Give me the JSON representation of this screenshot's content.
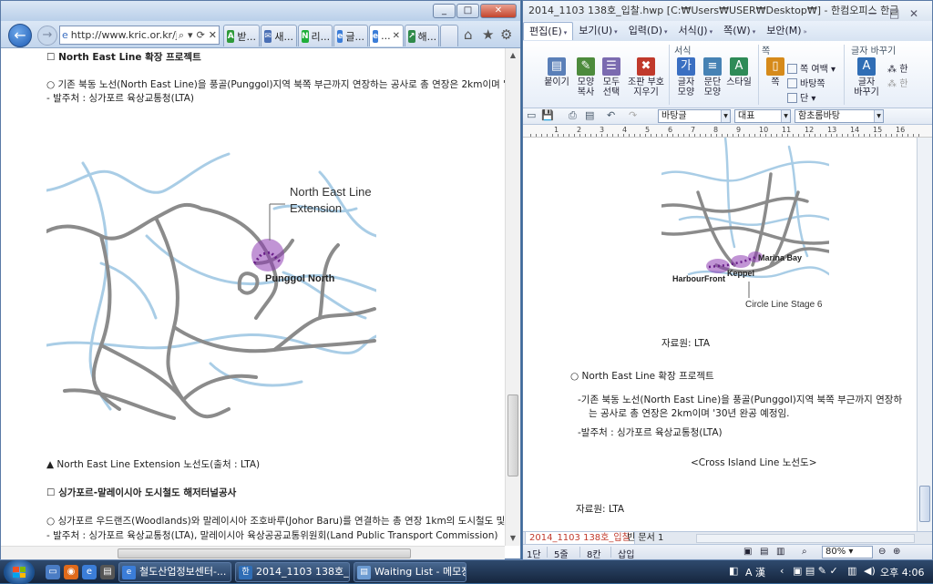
{
  "ie": {
    "window_buttons": [
      "_",
      "□",
      "✕"
    ],
    "address_url": "http://www.kric.or.kr/js",
    "address_actions": [
      "⌕",
      "▾",
      "⟳",
      "✕"
    ],
    "tabs": [
      {
        "label": "받...",
        "icon": "green-tab-icon",
        "color": "#2f9a3a",
        "glyph": "A"
      },
      {
        "label": "새...",
        "icon": "mail-tab-icon",
        "color": "#4a6fb5",
        "glyph": "✉"
      },
      {
        "label": "리...",
        "icon": "naver-tab-icon",
        "color": "#1fae3a",
        "glyph": "N"
      },
      {
        "label": "글...",
        "icon": "ie-tab-icon",
        "color": "#3b7dd8",
        "glyph": "e"
      },
      {
        "label": "...",
        "icon": "ie-tab-icon",
        "color": "#3b7dd8",
        "glyph": "e",
        "active": true
      },
      {
        "label": "해...",
        "icon": "green-arrow-tab-icon",
        "color": "#2f8a4a",
        "glyph": "↗"
      }
    ],
    "right_icons": [
      "⌂",
      "★",
      "⚙"
    ],
    "content": {
      "heading1": "☐ North East Line 확장 프로젝트",
      "bullet1": "○ 기존 북동 노선(North East Line)을 풍골(Punggol)지역 북쪽 부근까지 연장하는 공사로 총 연장은 2km이며 '",
      "owner1": "- 발주처 : 싱가포르 육상교통청(LTA)",
      "map_label_title_line1": "North East Line",
      "map_label_title_line2": "Extension",
      "map_label_station": "Punggol North",
      "caption": "▲ North East Line Extension 노선도(출처 : LTA)",
      "heading2": "☐ 싱가포르-말레이시아 도시철도 해저터널공사",
      "bullet2": "○ 싱가포르 우드랜즈(Woodlands)와 말레이시아 조호바루(Johor Baru)를 연결하는 총 연장 1km의 도시철도 및",
      "owner2": "- 발주처 : 싱가포르 육상교통청(LTA), 말레이시아 육상공공교통위원회(Land Public Transport Commission)"
    }
  },
  "hwp": {
    "title": "2014_1103 138호_입찰.hwp [C:₩Users₩USER₩Desktop₩] - 한컴오피스 한글",
    "title_buttons": [
      "─",
      "□",
      "✕"
    ],
    "menu": [
      {
        "label": "편집(E)",
        "active": true
      },
      {
        "label": "보기(U)"
      },
      {
        "label": "입력(D)"
      },
      {
        "label": "서식(J)"
      },
      {
        "label": "쪽(W)"
      },
      {
        "label": "보안(M)"
      }
    ],
    "ribbon": {
      "group_format": "서식",
      "group_page": "쪽",
      "group_char": "글자 바꾸기",
      "buttons": [
        {
          "label": "붙이기",
          "icon": "paste-icon",
          "color": "#5a7fb8",
          "glyph": "▤"
        },
        {
          "label": "모양\n복사",
          "icon": "format-painter-icon",
          "color": "#4d8b3c",
          "glyph": "✎"
        },
        {
          "label": "모두\n선택",
          "icon": "select-all-icon",
          "color": "#7b6bb0",
          "glyph": "☰"
        },
        {
          "label": "조판 부호\n지우기",
          "icon": "clear-code-icon",
          "color": "#c0392b",
          "glyph": "✖"
        },
        {
          "label": "글자\n모양",
          "icon": "char-shape-icon",
          "color": "#3a6fc2",
          "glyph": "가"
        },
        {
          "label": "문단\n모양",
          "icon": "para-shape-icon",
          "color": "#4682b4",
          "glyph": "≡"
        },
        {
          "label": "스타일",
          "icon": "style-icon",
          "color": "#2e8b57",
          "glyph": "A"
        },
        {
          "label": "쪽",
          "icon": "page-icon",
          "color": "#d68a1a",
          "glyph": "▯"
        },
        {
          "label": "글자\n바꾸기",
          "icon": "char-replace-icon",
          "color": "#2f6db5",
          "glyph": "A"
        }
      ],
      "small_items": [
        "쪽 여백",
        "바탕쪽",
        "단",
        "한",
        "한"
      ]
    },
    "toolbar": {
      "font_combo": "바탕글",
      "size_combo": "대표",
      "font_name": "함초롬바탕"
    },
    "ruler_numbers": [
      "1",
      "2",
      "3",
      "4",
      "5",
      "6",
      "7",
      "8",
      "9",
      "10",
      "11",
      "12",
      "13",
      "14",
      "15",
      "16"
    ],
    "page": {
      "map_label_marina": "Marina Bay",
      "map_label_keppel": "Keppel",
      "map_label_harbourfront": "HarbourFront",
      "map_label_stage": "Circle Line Stage 6",
      "source1": "자료원: LTA",
      "heading": "○ North East Line 확장 프로젝트",
      "para_line1": "-기존 북동 노선(North East Line)을 풍골(Punggol)지역 북쪽 부근까지 연장하",
      "para_line2": "는 공사로 총 연장은 2km이며 '30년 완공 예정임.",
      "owner": "-발주처 : 싱가포르 육상교통청(LTA)",
      "caption": "<Cross Island Line 노선도>",
      "source2": "자료원: LTA"
    },
    "doc_tabs": [
      "2014_1103 138호_입찰",
      "빈 문서 1"
    ],
    "status": {
      "page": "1단",
      "line": "5줄",
      "col": "8칸",
      "mode": "삽입",
      "zoom": "80%"
    }
  },
  "taskbar": {
    "tasks": [
      {
        "label": "철도산업정보센터-...",
        "icon": "ie-task-icon",
        "color": "#3b7dd8",
        "glyph": "e"
      },
      {
        "label": "2014_1103 138호_...",
        "icon": "hwp-task-icon",
        "color": "#2f6db5",
        "glyph": "한"
      },
      {
        "label": "Waiting List - 메모장",
        "icon": "notepad-task-icon",
        "color": "#6c9bd2",
        "glyph": "▤"
      }
    ],
    "tray_ime": "A 漢",
    "clock": "오후 4:06"
  }
}
